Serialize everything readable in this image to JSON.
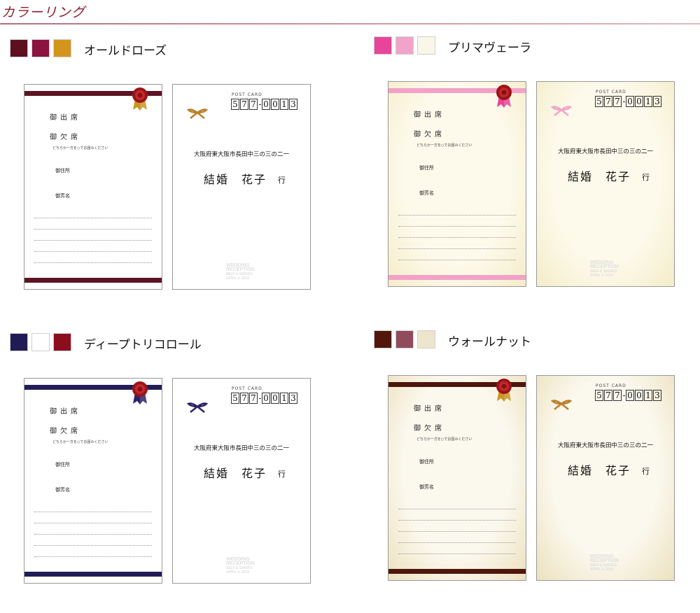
{
  "page": {
    "heading": "カラーリング"
  },
  "card_text": {
    "attend": "御出席",
    "absent": "御欠席",
    "note": "どちらか一方を○でお囲みください",
    "address_label": "御住所",
    "name_label": "御芳名",
    "post_card": "POST CARD",
    "zip_digits": [
      "5",
      "7",
      "7",
      "0",
      "0",
      "1",
      "3"
    ],
    "recipient_address": "大阪府東大阪市長田中三の三の二一",
    "recipient_name": "結婚　花子",
    "recipient_suffix": "行",
    "watermark": [
      "WEDDING",
      "RECEPTION",
      "SEIJI & SAKIKO",
      "APRIL 4, 2010"
    ]
  },
  "schemes": [
    {
      "name": "オールドローズ",
      "swatches": [
        "#5e1020",
        "#8c1240",
        "#d4951e"
      ],
      "band": "#5c1424",
      "bow": "#b8812e",
      "ribbon": "#c99520",
      "bg": "#ffffff",
      "bg_edge": "#ffffff"
    },
    {
      "name": "プリマヴェーラ",
      "swatches": [
        "#e8459a",
        "#f1a3c9",
        "#fbf7e8"
      ],
      "band": "#f2a1c8",
      "bow": "#f2a6c9",
      "ribbon": "#e8459a",
      "bg": "#fdfaec",
      "bg_edge": "#f4ecc8"
    },
    {
      "name": "ディープトリコロール",
      "swatches": [
        "#201a55",
        "#ffffff",
        "#8c0d1c"
      ],
      "band": "#211d57",
      "bow": "#2a2368",
      "ribbon": "#2a2368",
      "bg": "#ffffff",
      "bg_edge": "#ffffff"
    },
    {
      "name": "ウォールナット",
      "swatches": [
        "#52160d",
        "#8f4c5c",
        "#ede5cc"
      ],
      "band": "#4e150c",
      "bow": "#b8812e",
      "ribbon": "#c99520",
      "bg": "#fbf8ee",
      "bg_edge": "#ece1be"
    }
  ]
}
